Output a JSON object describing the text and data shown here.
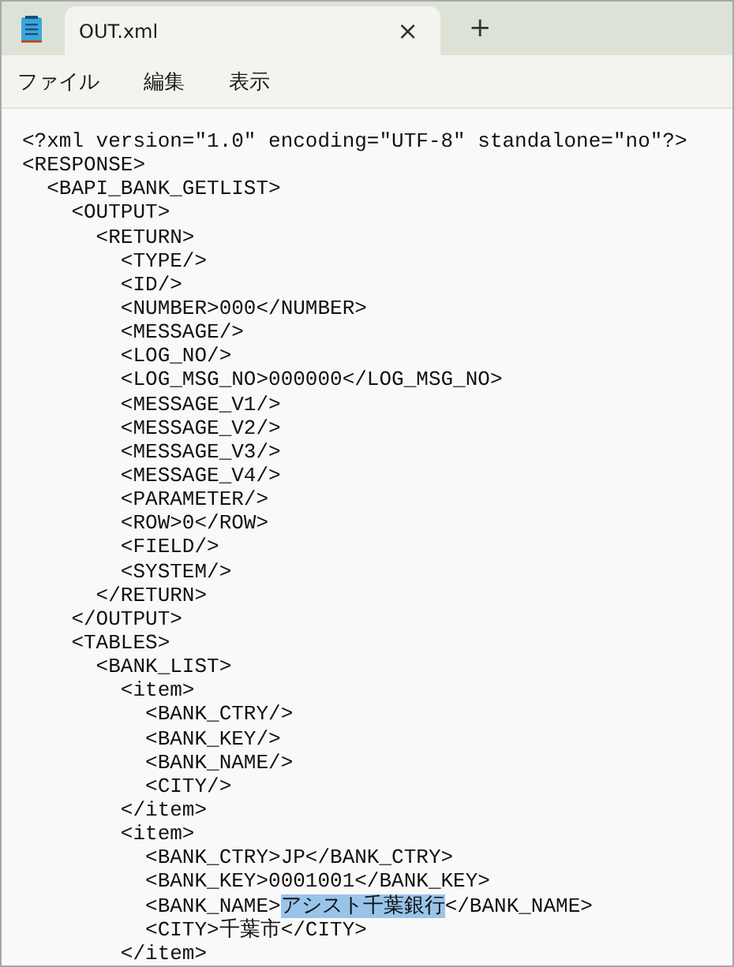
{
  "tabs": [
    {
      "title": "OUT.xml",
      "selected": true,
      "close": "×"
    }
  ],
  "new_tab": "+",
  "menu": [
    "ファイル",
    "編集",
    "表示"
  ],
  "lines": [
    {
      "text": "<?xml version=\"1.0\" encoding=\"UTF-8\" standalone=\"no\"?>"
    },
    {
      "text": "<RESPONSE>"
    },
    {
      "text": "  <BAPI_BANK_GETLIST>"
    },
    {
      "text": "    <OUTPUT>"
    },
    {
      "text": "      <RETURN>"
    },
    {
      "text": "        <TYPE/>"
    },
    {
      "text": "        <ID/>"
    },
    {
      "text": "        <NUMBER>000</NUMBER>"
    },
    {
      "text": "        <MESSAGE/>"
    },
    {
      "text": "        <LOG_NO/>"
    },
    {
      "text": "        <LOG_MSG_NO>000000</LOG_MSG_NO>"
    },
    {
      "text": "        <MESSAGE_V1/>"
    },
    {
      "text": "        <MESSAGE_V2/>"
    },
    {
      "text": "        <MESSAGE_V3/>"
    },
    {
      "text": "        <MESSAGE_V4/>"
    },
    {
      "text": "        <PARAMETER/>"
    },
    {
      "text": "        <ROW>0</ROW>"
    },
    {
      "text": "        <FIELD/>"
    },
    {
      "text": "        <SYSTEM/>"
    },
    {
      "text": "      </RETURN>"
    },
    {
      "text": "    </OUTPUT>"
    },
    {
      "text": "    <TABLES>"
    },
    {
      "text": "      <BANK_LIST>"
    },
    {
      "text": "        <item>"
    },
    {
      "text": "          <BANK_CTRY/>"
    },
    {
      "text": "          <BANK_KEY/>"
    },
    {
      "text": "          <BANK_NAME/>"
    },
    {
      "text": "          <CITY/>"
    },
    {
      "text": "        </item>"
    },
    {
      "text": "        <item>"
    },
    {
      "text": "          <BANK_CTRY>JP</BANK_CTRY>"
    },
    {
      "text": "          <BANK_KEY>0001001</BANK_KEY>"
    },
    {
      "segments": [
        {
          "text": "          <BANK_NAME>",
          "selected": false
        },
        {
          "text": "アシスト千葉銀行",
          "selected": true
        },
        {
          "text": "</BANK_NAME>",
          "selected": false
        }
      ]
    },
    {
      "text": "          <CITY>千葉市</CITY>"
    },
    {
      "text": "        </item>"
    }
  ]
}
